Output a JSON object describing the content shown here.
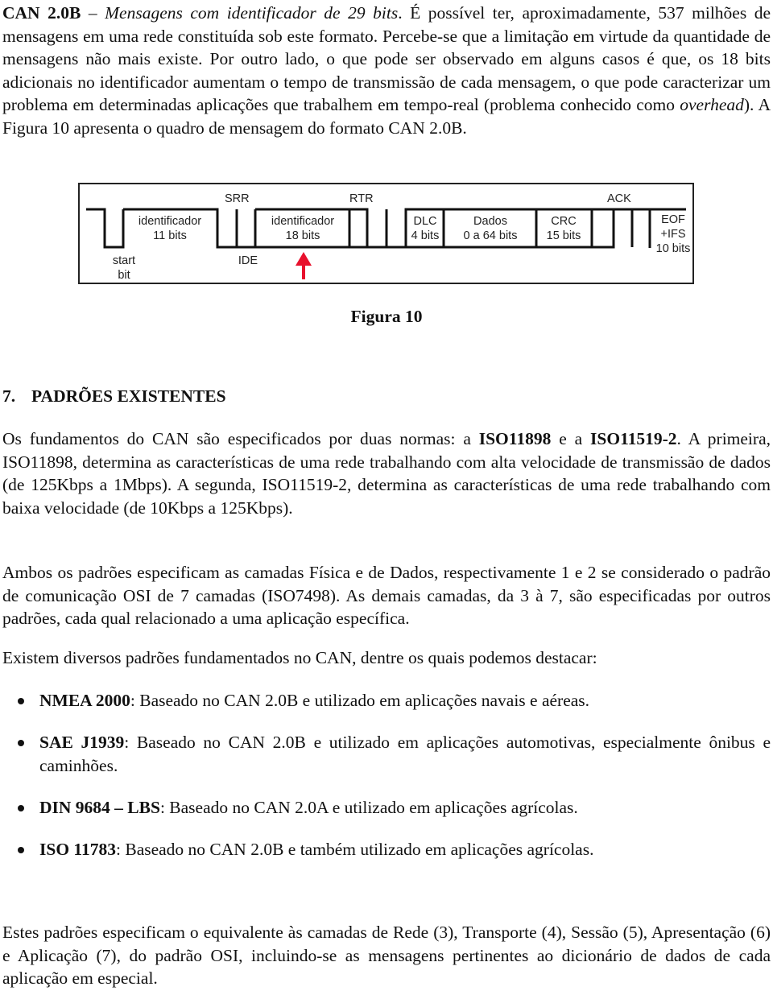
{
  "intro": {
    "lead_bold": "CAN 2.0B",
    "lead_dash": " – ",
    "lead_italic": "Mensagens com identificador de 29 bits",
    "text1": ". É possível ter, aproximadamente, 537 milhões de mensagens em uma rede constituída sob este formato. Percebe-se que a limitação em virtude da quantidade de mensagens não mais existe. Por outro lado, o que pode ser observado em alguns casos é que, os 18 bits adicionais no identificador aumentam o tempo de transmissão de cada mensagem, o que pode caracterizar um problema em determinadas aplicações que trabalhem em tempo-real (problema conhecido como ",
    "overhead_italic": "overhead",
    "text2": "). A Figura 10 apresenta o quadro de mensagem do formato CAN 2.0B."
  },
  "figure": {
    "caption": "Figura 10",
    "labels": {
      "srr": "SRR",
      "rtr": "RTR",
      "ack": "ACK",
      "ide": "IDE",
      "start_line1": "start",
      "start_line2": "bit",
      "id11_line1": "identificador",
      "id11_line2": "11 bits",
      "id18_line1": "identificador",
      "id18_line2": "18 bits",
      "dlc_line1": "DLC",
      "dlc_line2": "4 bits",
      "dados_line1": "Dados",
      "dados_line2": "0 a 64 bits",
      "crc_line1": "CRC",
      "crc_line2": "15 bits",
      "eof_line1": "EOF",
      "eof_line2": "+IFS",
      "eof_line3": "10 bits"
    },
    "arrow_color": "#e8112d"
  },
  "section": {
    "number": "7.",
    "title": "PADRÕES EXISTENTES"
  },
  "p1": {
    "t1": "Os fundamentos do CAN são especificados por duas normas: a ",
    "b1": "ISO11898",
    "t2": " e a ",
    "b2": "ISO11519-2",
    "t3": ". A primeira, ISO11898, determina as características de uma rede trabalhando com alta velocidade de transmissão de dados (de 125Kbps a 1Mbps). A segunda, ISO11519-2, determina as características de uma rede trabalhando com baixa velocidade (de 10Kbps a 125Kbps)."
  },
  "p2": "Ambos os padrões especificam as camadas Física e de Dados, respectivamente 1 e 2 se considerado o padrão de comunicação OSI de 7 camadas (ISO7498). As demais camadas, da 3 à 7, são especificadas por outros padrões, cada qual relacionado a uma aplicação específica.",
  "p3": "Existem diversos padrões fundamentados no CAN, dentre os quais podemos destacar:",
  "standards": [
    {
      "name": "NMEA 2000",
      "desc": ": Baseado no CAN 2.0B e utilizado em aplicações navais e aéreas."
    },
    {
      "name": "SAE J1939",
      "desc": ": Baseado no CAN 2.0B e utilizado em aplicações automotivas, especialmente ônibus e caminhões."
    },
    {
      "name": "DIN 9684 – LBS",
      "desc": ": Baseado no CAN 2.0A e utilizado em aplicações agrícolas."
    },
    {
      "name": "ISO 11783",
      "desc": ": Baseado no CAN 2.0B e também utilizado em aplicações agrícolas."
    }
  ],
  "p4": "Estes padrões especificam o equivalente às camadas de Rede (3), Transporte (4), Sessão (5), Apresentação (6) e Aplicação (7), do padrão OSI, incluindo-se as mensagens pertinentes ao dicionário de dados de cada aplicação em especial."
}
